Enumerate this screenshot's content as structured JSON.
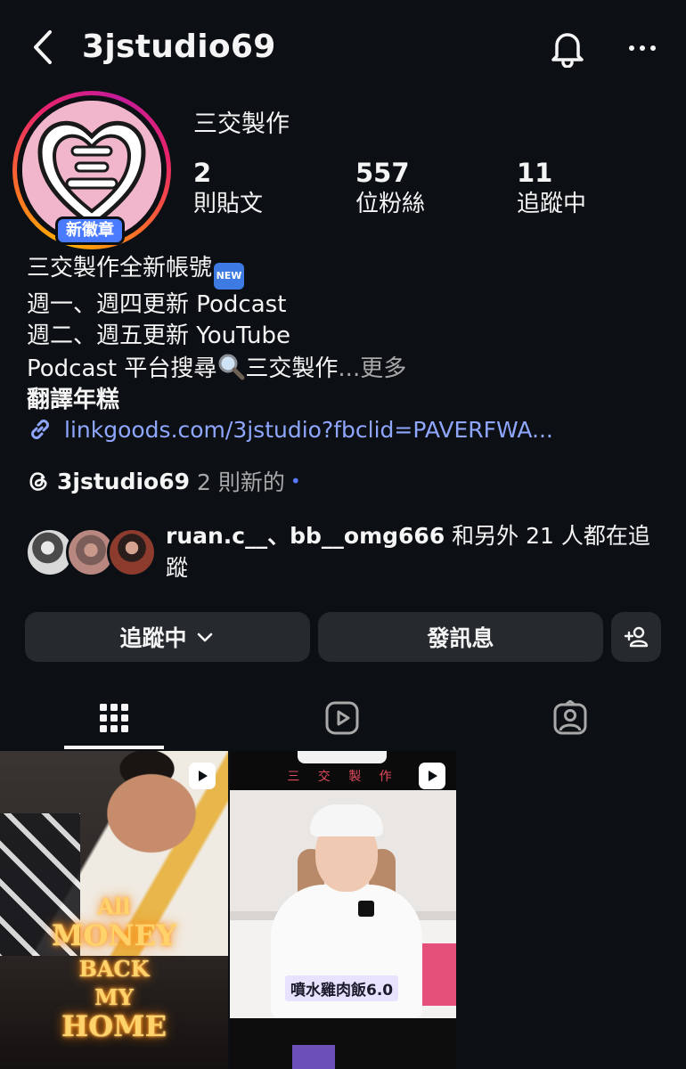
{
  "header": {
    "username": "3jstudio69"
  },
  "profile": {
    "display_name": "三交製作",
    "badge": "新徽章",
    "stats": [
      {
        "value": "2",
        "label": "則貼文"
      },
      {
        "value": "557",
        "label": "位粉絲"
      },
      {
        "value": "11",
        "label": "追蹤中"
      }
    ],
    "bio": {
      "line1": "三交製作全新帳號",
      "new_emoji": "NEW",
      "line2": "週一、週四更新 Podcast",
      "line3": "週二、週五更新 YouTube",
      "line4_prefix": "Podcast 平台搜尋",
      "line4_suffix": "三交製作",
      "ellipsis": "...",
      "more": "更多",
      "line5": "翻譯年糕"
    },
    "link": "linkgoods.com/3jstudio?fbclid=PAVERFWA...",
    "threads": {
      "handle": "3jstudio69",
      "new_count": "2 則新的",
      "dot": "•"
    },
    "followed_by": {
      "names": "ruan.c__、bb__omg666",
      "rest": " 和另外 21 人都在追蹤"
    }
  },
  "actions": {
    "following": "追蹤中",
    "message": "發訊息"
  },
  "grid": {
    "tile1_text": [
      "All",
      "MONEY",
      "BACK",
      "MY",
      "HOME"
    ],
    "tile2_brand": "三 交 製 作",
    "tile2_caption": "噴水雞肉飯6.0"
  },
  "colors": {
    "background": "#0c1014",
    "link": "#8fa6ff",
    "button": "#262a2e",
    "badge": "#4a7bff"
  }
}
